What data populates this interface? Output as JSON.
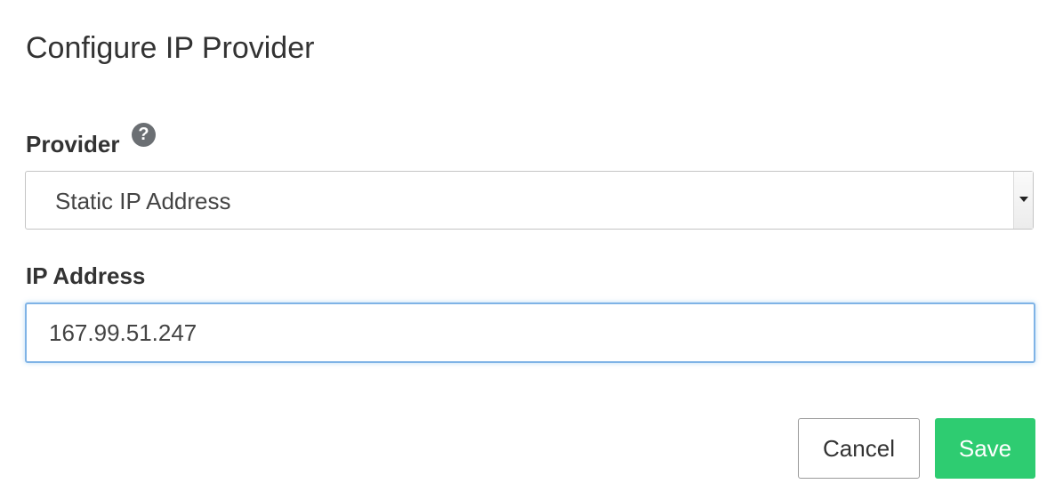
{
  "dialog": {
    "title": "Configure IP Provider"
  },
  "provider": {
    "label": "Provider",
    "help_icon": "question-circle-icon",
    "help_glyph": "?",
    "selected_value": "Static IP Address"
  },
  "ip_address": {
    "label": "IP Address",
    "value": "167.99.51.247"
  },
  "actions": {
    "cancel_label": "Cancel",
    "save_label": "Save"
  },
  "colors": {
    "primary_save": "#2ecc71",
    "focus_border": "#7fb3e6",
    "help_icon_bg": "#6b6f73"
  }
}
